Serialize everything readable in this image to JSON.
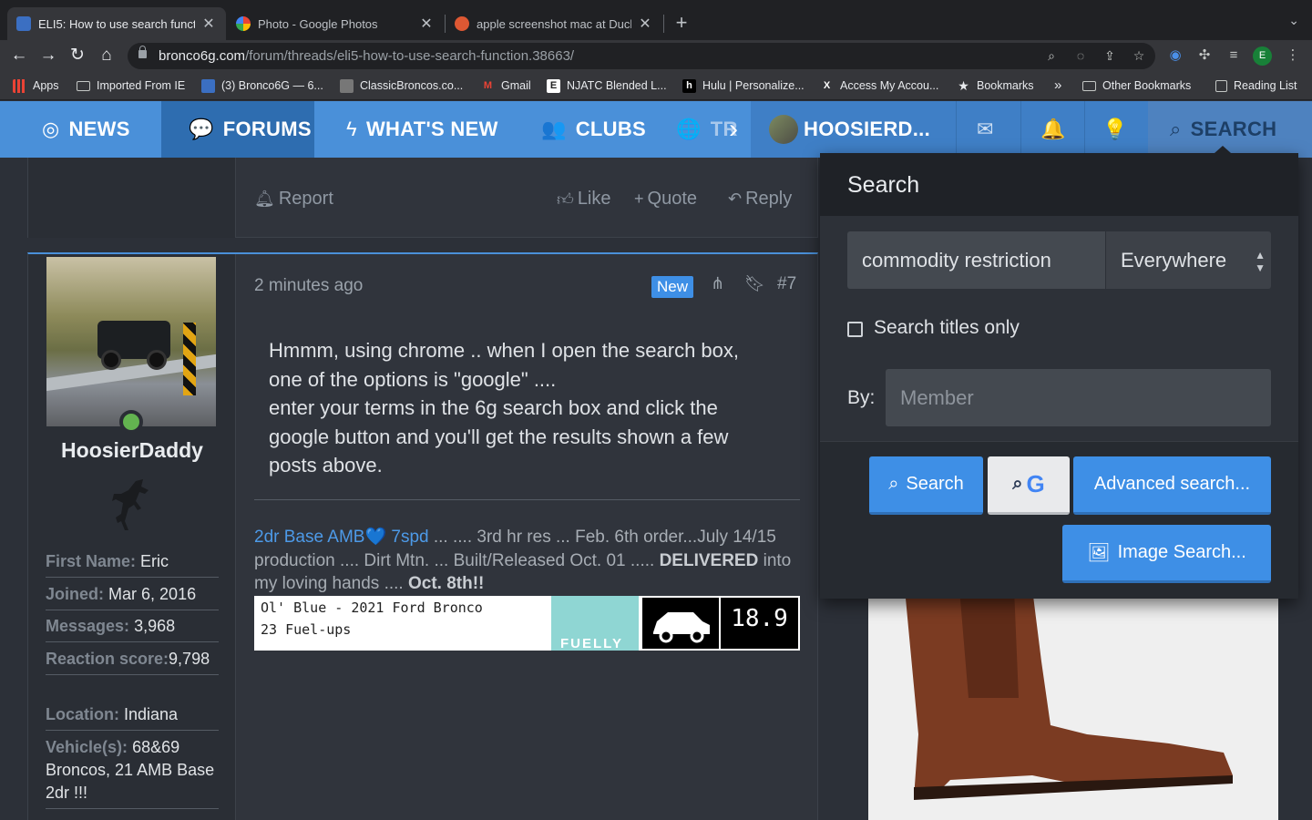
{
  "browser": {
    "tabs": [
      {
        "title": "ELI5: How to use search functi",
        "active": true
      },
      {
        "title": "Photo - Google Photos",
        "active": false
      },
      {
        "title": "apple screenshot mac at Duck",
        "active": false
      }
    ],
    "url_domain": "bronco6g.com",
    "url_path": "/forum/threads/eli5-how-to-use-search-function.38663/",
    "profile_initial": "E",
    "bookmarks": [
      {
        "label": "Apps"
      },
      {
        "label": "Imported From IE"
      },
      {
        "label": "(3) Bronco6G — 6..."
      },
      {
        "label": "ClassicBroncos.co..."
      },
      {
        "label": "Gmail"
      },
      {
        "label": "NJATC Blended L..."
      },
      {
        "label": "Hulu | Personalize..."
      },
      {
        "label": "Access My Accou..."
      },
      {
        "label": "Bookmarks"
      },
      {
        "label": "Other Bookmarks"
      },
      {
        "label": "Reading List"
      }
    ],
    "bookmarks_overflow": "»"
  },
  "nav": {
    "news": "NEWS",
    "forums": "FORUMS",
    "whats_new": "WHAT'S NEW",
    "clubs": "CLUBS",
    "tr_partial": "TR",
    "username": "HOOSIERD...",
    "search": "SEARCH"
  },
  "post_prev": {
    "report": "Report",
    "like": "Like",
    "quote": "Quote",
    "reply": "Reply"
  },
  "post": {
    "time": "2 minutes ago",
    "badge": "New",
    "number": "#7",
    "message_lines": [
      "Hmmm, using chrome .. when I open the search box,",
      "one of the options is \"google\" ....",
      "enter your terms in the 6g search box and click the",
      "google button and you'll get the results shown a few",
      "posts above."
    ],
    "signature": {
      "link": "2dr Base AMB💙 7spd",
      "text1": " ... .... 3rd hr res ... Feb. 6th order...July 14/15 production .... Dirt Mtn. ... Built/Released Oct. 01 ..... ",
      "bold1": "DELIVERED",
      "text2": " into my loving hands .... ",
      "bold2": "Oct. 8th!!",
      "banner_line1": "Ol' Blue - 2021 Ford Bronco",
      "banner_line2": "23 Fuel-ups",
      "banner_brand": "FUELLY",
      "banner_mpg": "18.9"
    }
  },
  "user": {
    "name": "HoosierDaddy",
    "fields": [
      {
        "key": "First Name:",
        "value": "Eric"
      },
      {
        "key": "Joined:",
        "value": "Mar 6, 2016"
      },
      {
        "key": "Messages:",
        "value": "3,968"
      },
      {
        "key": "Reaction score:",
        "value": "9,798"
      },
      {
        "key": "Location:",
        "value": "Indiana"
      },
      {
        "key": "Vehicle(s):",
        "value": "68&69 Broncos, 21 AMB Base 2dr !!!"
      }
    ]
  },
  "search_panel": {
    "title": "Search",
    "query": "commodity restriction",
    "scope": "Everywhere",
    "titles_only_label": "Search titles only",
    "by_label": "By:",
    "member_placeholder": "Member",
    "search_btn": "Search",
    "advanced_btn": "Advanced search...",
    "image_btn": "Image Search..."
  }
}
